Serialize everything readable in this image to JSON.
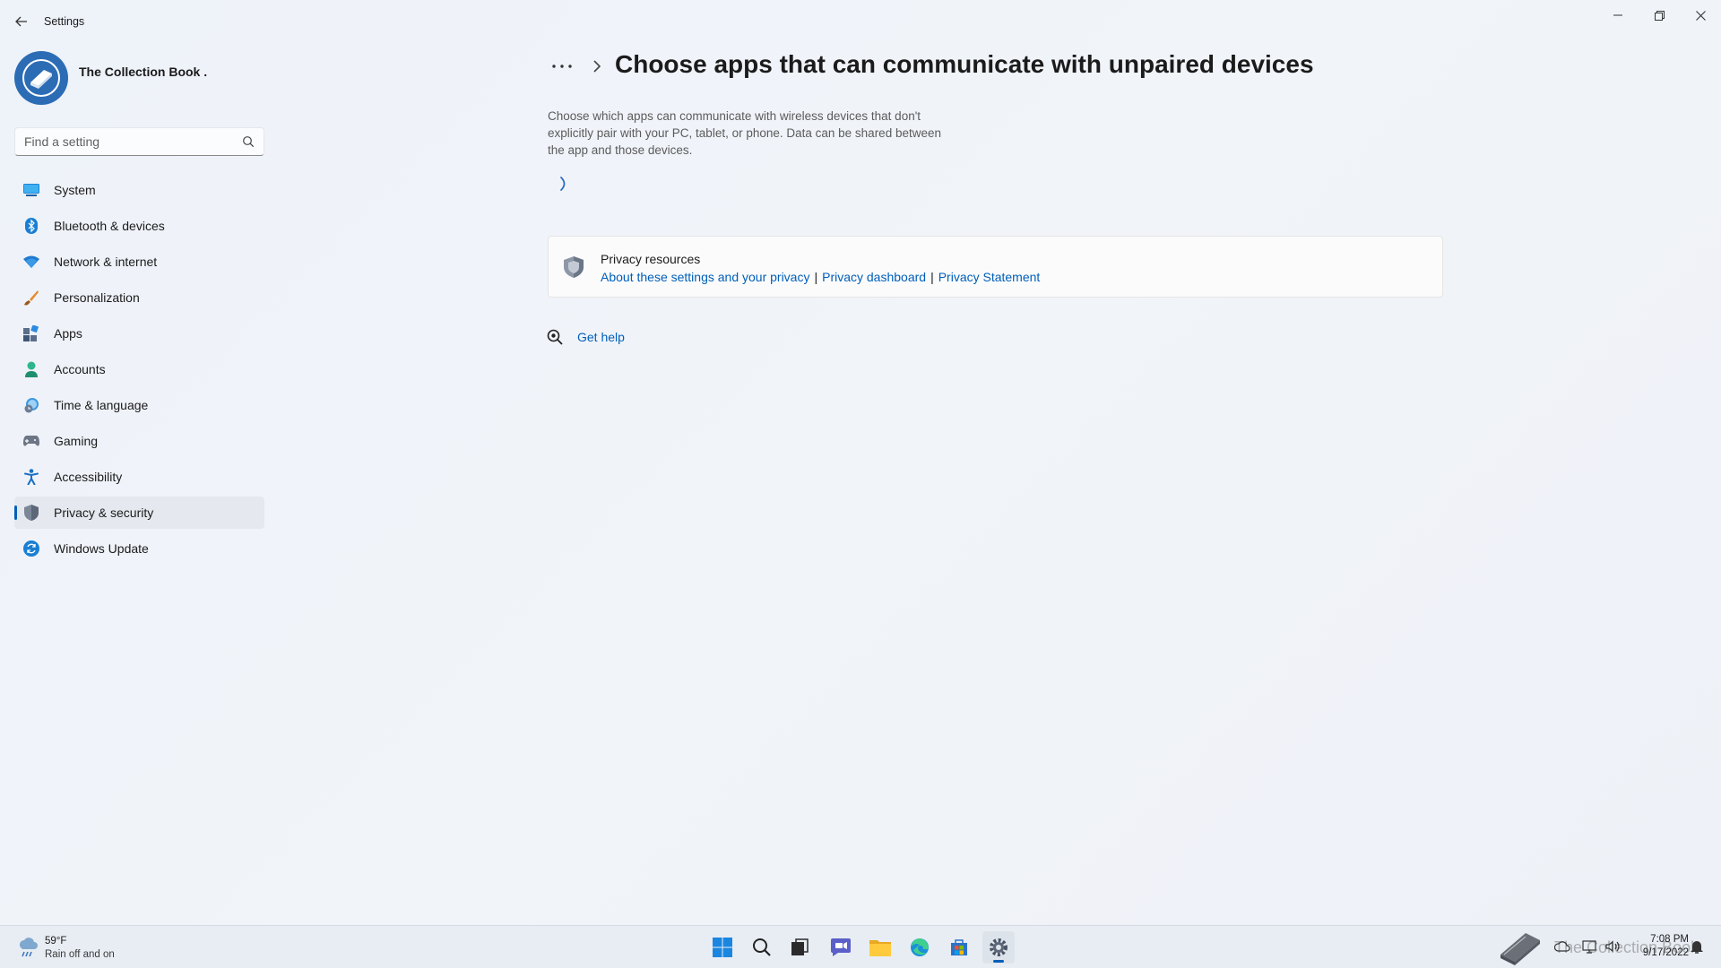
{
  "window": {
    "title": "Settings",
    "back_icon": "back-arrow-icon",
    "controls": [
      "minimize-icon",
      "restore-icon",
      "close-icon"
    ]
  },
  "sidebar": {
    "profile_name": "The Collection Book .",
    "search_placeholder": "Find a setting",
    "items": [
      {
        "label": "System",
        "icon": "system-icon"
      },
      {
        "label": "Bluetooth & devices",
        "icon": "bluetooth-icon"
      },
      {
        "label": "Network & internet",
        "icon": "network-icon"
      },
      {
        "label": "Personalization",
        "icon": "personalization-icon"
      },
      {
        "label": "Apps",
        "icon": "apps-icon"
      },
      {
        "label": "Accounts",
        "icon": "accounts-icon"
      },
      {
        "label": "Time & language",
        "icon": "time-language-icon"
      },
      {
        "label": "Gaming",
        "icon": "gaming-icon"
      },
      {
        "label": "Accessibility",
        "icon": "accessibility-icon"
      },
      {
        "label": "Privacy & security",
        "icon": "privacy-shield-icon",
        "active": true
      },
      {
        "label": "Windows Update",
        "icon": "windows-update-icon"
      }
    ]
  },
  "main": {
    "breadcrumb_more": "•••",
    "title": "Choose apps that can communicate with unpaired devices",
    "description": "Choose which apps can communicate with wireless devices that don't explicitly pair with your PC, tablet, or phone. Data can be shared between the app and those devices.",
    "privacy_resources": {
      "title": "Privacy resources",
      "links": [
        "About these settings and your privacy",
        "Privacy dashboard",
        "Privacy Statement"
      ],
      "separator": "|"
    },
    "get_help": "Get help"
  },
  "taskbar": {
    "weather": {
      "temp": "59°F",
      "condition": "Rain off and on"
    },
    "apps": [
      "windows-start-icon",
      "search-icon",
      "task-view-icon",
      "chat-icon",
      "file-explorer-icon",
      "edge-icon",
      "store-icon",
      "settings-icon"
    ],
    "tray_text": "The Collection Book",
    "time": "7:08 PM",
    "date": "9/17/2022"
  },
  "colors": {
    "accent": "#005fb8",
    "background": "#eef2f8",
    "card": "#fbfbfc"
  }
}
